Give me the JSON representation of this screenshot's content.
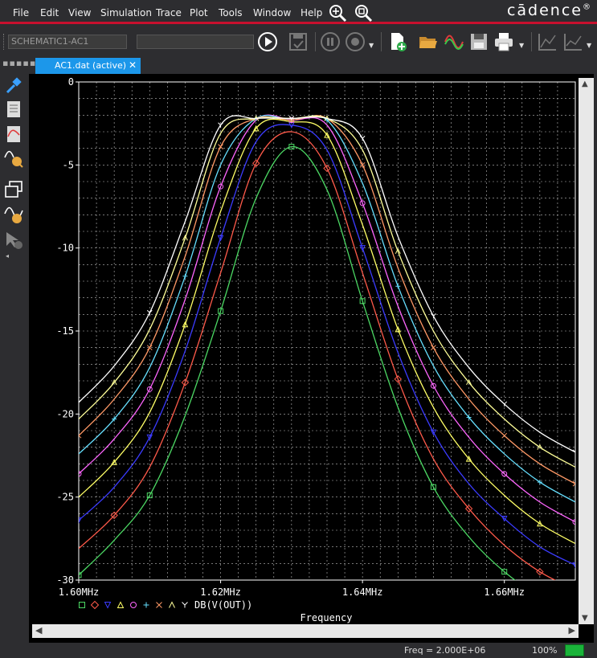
{
  "menu": [
    "File",
    "Edit",
    "View",
    "Simulation",
    "Trace",
    "Plot",
    "Tools",
    "Window",
    "Help"
  ],
  "brand": "cādence",
  "brand_mark": "®",
  "toolbar": {
    "schematic": "SCHEMATIC1-AC1",
    "profile": ""
  },
  "tab": {
    "label": "AC1.dat (active)",
    "close": "✕"
  },
  "status": {
    "freq": "Freq = 2.000E+06",
    "zoom": "100%",
    "led_color": "#1ab33a"
  },
  "legend": {
    "trace_expr": "DB(V(OUT))",
    "xaxis_label": "Frequency"
  },
  "icons": [
    "zoom-in-icon",
    "zoom-fit-icon",
    "run-icon",
    "pause-icon",
    "stop-icon",
    "new-file-icon",
    "open-folder-icon",
    "save-icon",
    "print-icon"
  ],
  "chart_data": {
    "type": "line",
    "title": "",
    "xlabel": "Frequency",
    "ylabel": "",
    "xlim": [
      1.6,
      1.67
    ],
    "ylim": [
      -30,
      0
    ],
    "x_unit": "MHz",
    "x_ticks": [
      1.6,
      1.62,
      1.64,
      1.66
    ],
    "x_tick_labels": [
      "1.60MHz",
      "1.62MHz",
      "1.64MHz",
      "1.66MHz"
    ],
    "y_ticks": [
      0,
      -5,
      -10,
      -15,
      -20,
      -25,
      -30
    ],
    "y_tick_labels": [
      "0",
      "-5",
      "-10",
      "-15",
      "-20",
      "-25",
      "-30"
    ],
    "grid": true,
    "background": "#000000",
    "x_sample": [
      1.6,
      1.605,
      1.61,
      1.615,
      1.62,
      1.625,
      1.63,
      1.635,
      1.64,
      1.645,
      1.65,
      1.655,
      1.66,
      1.665,
      1.67
    ],
    "series": [
      {
        "marker": "square",
        "color": "#4cd964",
        "values": [
          -29.7,
          -27.6,
          -24.9,
          -20.1,
          -13.8,
          -7.0,
          -3.9,
          -6.5,
          -13.2,
          -19.6,
          -24.4,
          -27.4,
          -29.5,
          -31.0,
          -32.1
        ]
      },
      {
        "marker": "diamond",
        "color": "#ff5a4a",
        "values": [
          -28.1,
          -26.1,
          -23.2,
          -18.1,
          -11.5,
          -4.9,
          -3.0,
          -5.2,
          -11.5,
          -17.9,
          -22.7,
          -25.7,
          -27.9,
          -29.5,
          -30.6
        ]
      },
      {
        "marker": "triangle-down",
        "color": "#3b3bff",
        "values": [
          -26.4,
          -24.4,
          -21.4,
          -16.2,
          -9.4,
          -3.6,
          -2.6,
          -4.1,
          -10.0,
          -16.3,
          -21.1,
          -24.2,
          -26.3,
          -28.0,
          -29.1
        ]
      },
      {
        "marker": "triangle-up",
        "color": "#ffff66",
        "values": [
          -25.0,
          -22.9,
          -19.9,
          -14.6,
          -7.8,
          -2.8,
          -2.4,
          -3.2,
          -8.6,
          -14.9,
          -19.6,
          -22.7,
          -24.9,
          -26.6,
          -27.8
        ]
      },
      {
        "marker": "circle",
        "color": "#ff66ff",
        "values": [
          -23.6,
          -21.5,
          -18.5,
          -13.1,
          -6.3,
          -2.3,
          -2.3,
          -2.6,
          -7.3,
          -13.5,
          -18.3,
          -21.4,
          -23.6,
          -25.3,
          -26.5
        ]
      },
      {
        "marker": "plus",
        "color": "#66e0ff",
        "values": [
          -22.4,
          -20.3,
          -17.2,
          -11.7,
          -5.0,
          -2.2,
          -2.3,
          -2.3,
          -6.1,
          -12.3,
          -17.1,
          -20.2,
          -22.4,
          -24.1,
          -25.3
        ]
      },
      {
        "marker": "x",
        "color": "#ff9966",
        "values": [
          -21.3,
          -19.1,
          -16.0,
          -10.5,
          -3.9,
          -2.2,
          -2.3,
          -2.2,
          -5.0,
          -11.2,
          -16.0,
          -19.1,
          -21.3,
          -23.0,
          -24.2
        ]
      },
      {
        "marker": "lambda",
        "color": "#ffff99",
        "values": [
          -20.3,
          -18.1,
          -14.9,
          -9.4,
          -3.1,
          -2.2,
          -2.2,
          -2.2,
          -4.1,
          -10.2,
          -15.0,
          -18.1,
          -20.3,
          -22.0,
          -23.2
        ]
      },
      {
        "marker": "y",
        "color": "#ffffff",
        "values": [
          -19.3,
          -17.1,
          -13.9,
          -8.4,
          -2.6,
          -2.2,
          -2.2,
          -2.2,
          -3.4,
          -9.3,
          -14.1,
          -17.2,
          -19.4,
          -21.1,
          -22.3
        ]
      }
    ]
  }
}
